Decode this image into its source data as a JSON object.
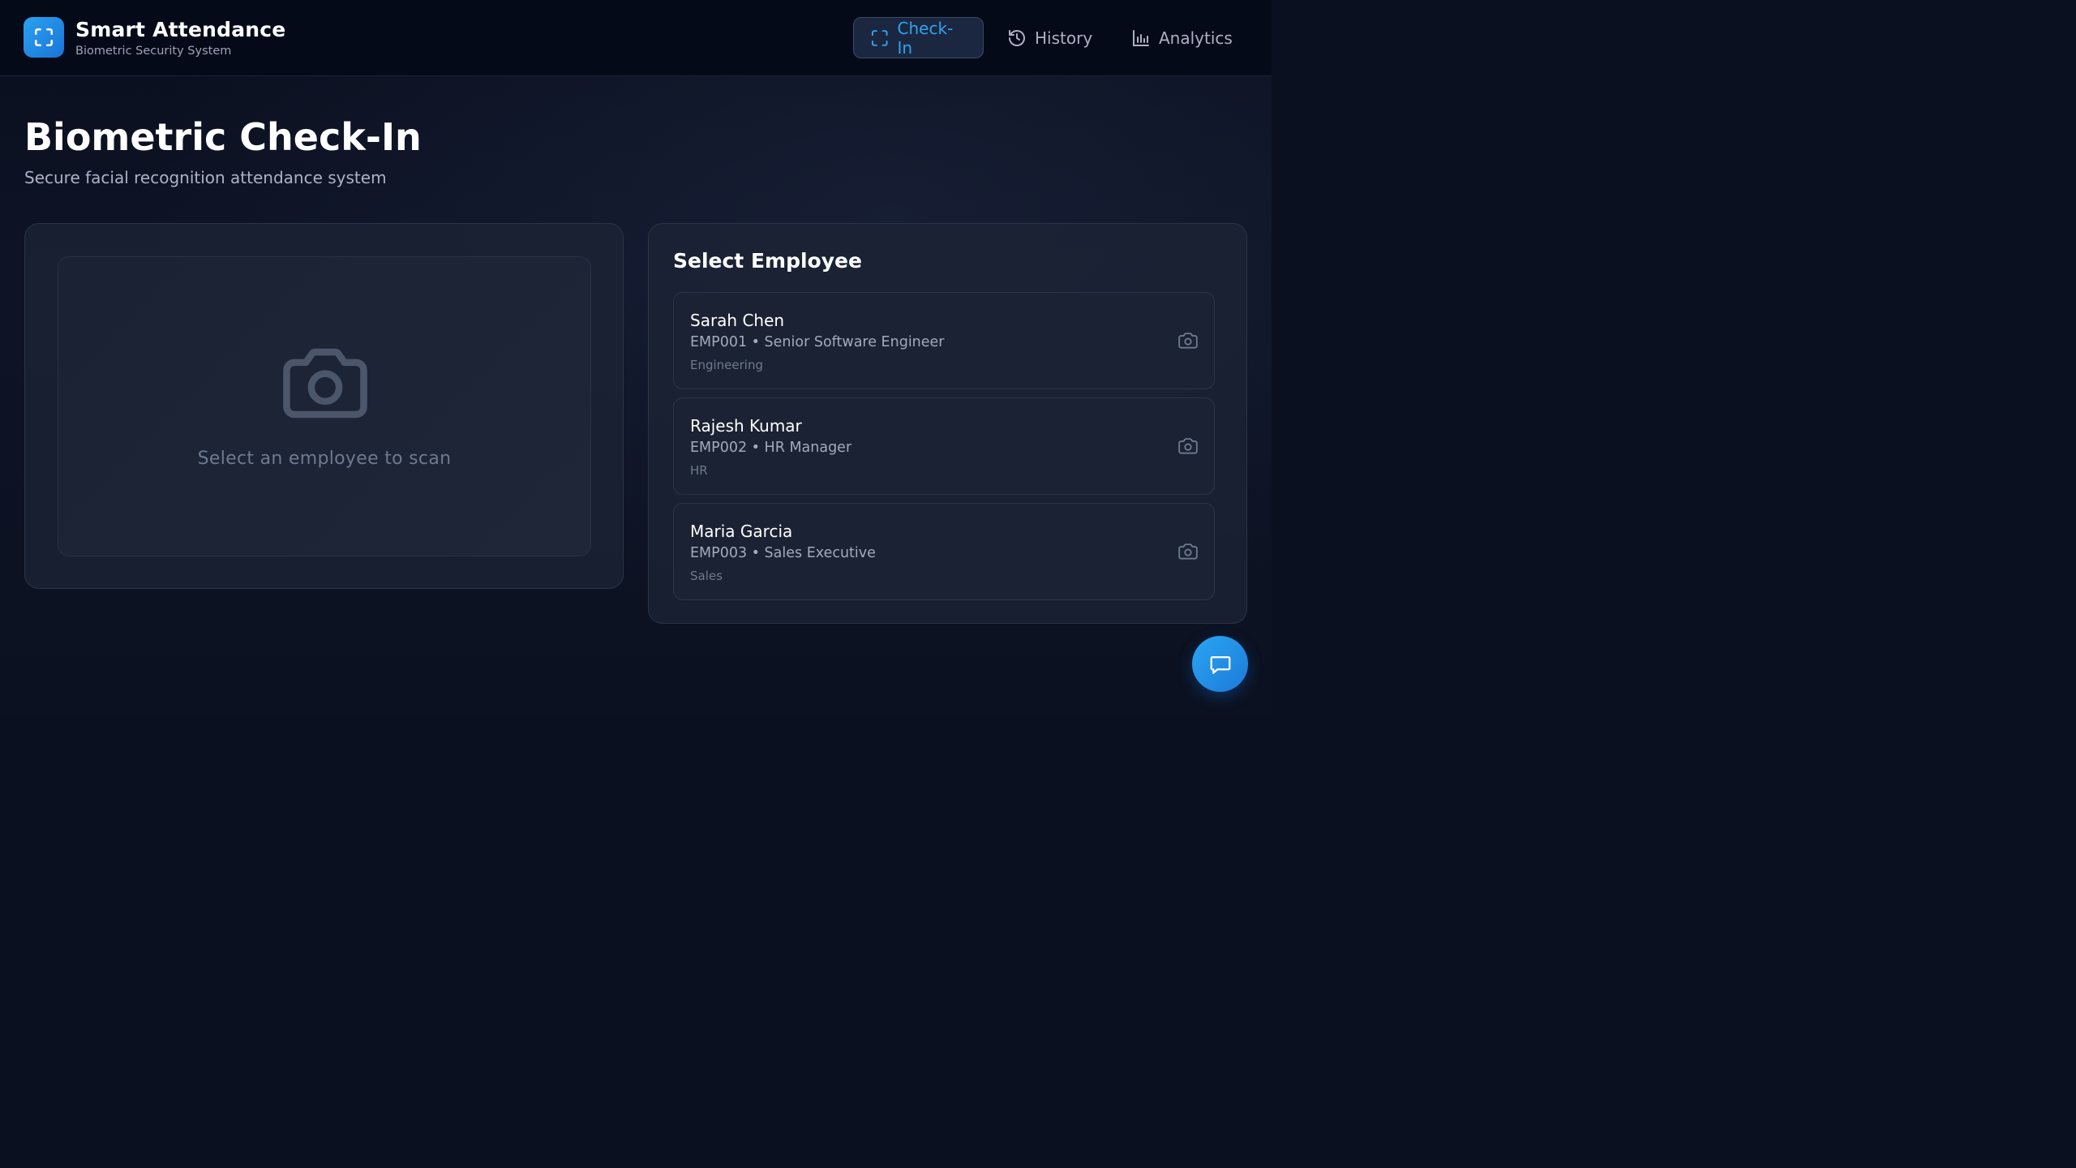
{
  "header": {
    "app_title": "Smart Attendance",
    "app_subtitle": "Biometric Security System",
    "logo_icon": "scan-frame-icon",
    "nav": [
      {
        "label": "Check-In",
        "icon": "scan-frame-icon",
        "active": true
      },
      {
        "label": "History",
        "icon": "history-clock-icon",
        "active": false
      },
      {
        "label": "Analytics",
        "icon": "bar-chart-icon",
        "active": false
      }
    ]
  },
  "main": {
    "title": "Biometric Check-In",
    "subtitle": "Secure facial recognition attendance system"
  },
  "scanner": {
    "icon": "camera-icon",
    "placeholder_text": "Select an employee to scan"
  },
  "employees": {
    "heading": "Select Employee",
    "items": [
      {
        "name": "Sarah Chen",
        "meta": "EMP001 • Senior Software Engineer",
        "department": "Engineering",
        "icon": "camera-icon"
      },
      {
        "name": "Rajesh Kumar",
        "meta": "EMP002 • HR Manager",
        "department": "HR",
        "icon": "camera-icon"
      },
      {
        "name": "Maria Garcia",
        "meta": "EMP003 • Sales Executive",
        "department": "Sales",
        "icon": "camera-icon"
      }
    ]
  },
  "chat": {
    "icon": "chat-bubble-icon"
  },
  "colors": {
    "accent": "#2ea4f0",
    "background": "#0b1020",
    "card": "#1c2436",
    "muted_text": "#6f7a8f"
  }
}
